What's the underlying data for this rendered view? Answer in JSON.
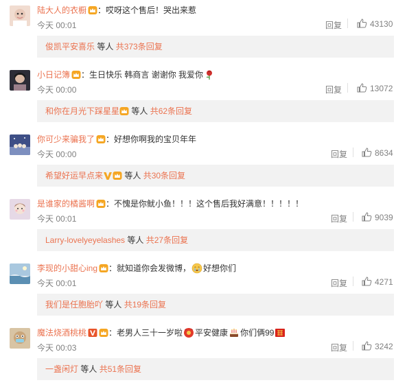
{
  "comments": [
    {
      "username": "陆大人的衣橱",
      "colon": "：",
      "text_parts": [
        "哎呀这个售后！哭出来惹"
      ],
      "time": "今天 00:01",
      "reply_label": "回复",
      "likes": "43130",
      "sub_user": "俊凯平安喜乐",
      "sub_mid": " 等人 ",
      "sub_total": "共373条回复",
      "avatar_color": "#e8c9b9"
    },
    {
      "username": "小日记簿",
      "colon": "：",
      "text_parts": [
        "生日快乐 韩商言 谢谢你 我爱你"
      ],
      "time": "今天 00:00",
      "reply_label": "回复",
      "likes": "13072",
      "sub_user": "和你在月光下踩星星",
      "sub_mid": " 等人 ",
      "sub_total": "共62条回复",
      "avatar_color": "#3a3a48"
    },
    {
      "username": "你可少来骗我了",
      "colon": "：",
      "text_parts": [
        "好想你啊我的宝贝年年"
      ],
      "time": "今天 00:00",
      "reply_label": "回复",
      "likes": "8634",
      "sub_user": "希望好运早点来",
      "sub_mid": " 等人 ",
      "sub_total": "共30条回复",
      "avatar_color": "#4a5a8a"
    },
    {
      "username": "是谁家的橘酱啊",
      "colon": "：",
      "text_parts": [
        "不愧是你鱿小鱼！！！这个售后我好满意！！！！！"
      ],
      "time": "今天 00:01",
      "reply_label": "回复",
      "likes": "9039",
      "sub_user": "Larry-lovelyeyelashes",
      "sub_mid": " 等人 ",
      "sub_total": "共27条回复",
      "avatar_color": "#d9c6d8"
    },
    {
      "username": "李现的小甜心ing",
      "colon": "：",
      "text_parts": [
        "就知道你会发微博，",
        "好想你们"
      ],
      "time": "今天 00:01",
      "reply_label": "回复",
      "likes": "4271",
      "sub_user": "我们是任胞胎吖",
      "sub_mid": " 等人 ",
      "sub_total": "共19条回复",
      "avatar_color": "#7fa6c6"
    },
    {
      "username": "魔法烧酒桃桃",
      "colon": "：",
      "text_parts": [
        "老男人三十一岁啦",
        "平安健康",
        "你们俩99"
      ],
      "time": "今天 00:03",
      "reply_label": "回复",
      "likes": "3242",
      "sub_user": "一盏闲灯",
      "sub_mid": " 等人 ",
      "sub_total": "共51条回复",
      "avatar_color": "#c9a57a"
    }
  ],
  "colors": {
    "username": "#eb7350",
    "meta": "#808080",
    "subbar_bg": "#f2f2f2"
  },
  "icons": [
    "vip-crown-icon",
    "v-badge-icon",
    "like-thumb-icon",
    "rose-emoji-icon",
    "cry-emoji-icon",
    "cake-emoji-icon",
    "red-envelope-emoji-icon",
    "hongbao-emoji-icon"
  ]
}
